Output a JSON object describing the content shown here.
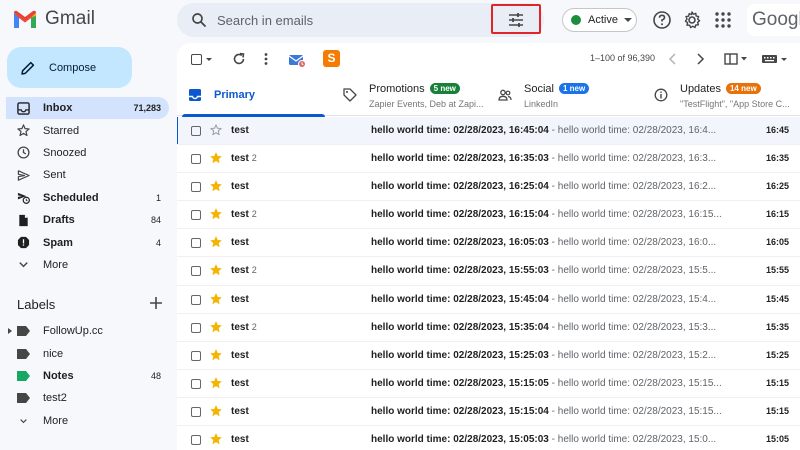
{
  "app": {
    "name": "Gmail",
    "brand": "Google"
  },
  "search": {
    "placeholder": "Search in emails"
  },
  "status": {
    "label": "Active",
    "color": "#1e8e3e"
  },
  "compose": {
    "label": "Compose"
  },
  "nav": [
    {
      "label": "Inbox",
      "count": "71,283",
      "icon": "inbox-icon",
      "active": true
    },
    {
      "label": "Starred",
      "count": "",
      "icon": "star-outline-icon"
    },
    {
      "label": "Snoozed",
      "count": "",
      "icon": "clock-icon"
    },
    {
      "label": "Sent",
      "count": "",
      "icon": "send-icon"
    },
    {
      "label": "Scheduled",
      "count": "1",
      "icon": "scheduled-send-icon",
      "bold": true
    },
    {
      "label": "Drafts",
      "count": "84",
      "icon": "draft-icon",
      "bold": true
    },
    {
      "label": "Spam",
      "count": "4",
      "icon": "spam-icon",
      "bold": true
    },
    {
      "label": "More",
      "count": "",
      "icon": "chevron-down-icon"
    }
  ],
  "labels": {
    "heading": "Labels",
    "items": [
      {
        "label": "FollowUp.cc",
        "count": "",
        "color": "#444746",
        "expandable": true
      },
      {
        "label": "nice",
        "count": "",
        "color": "#444746"
      },
      {
        "label": "Notes",
        "count": "48",
        "color": "#16a765",
        "bold": true
      },
      {
        "label": "test2",
        "count": "",
        "color": "#444746"
      },
      {
        "label": "More",
        "count": "",
        "icon": "chevron-down-icon"
      }
    ]
  },
  "toolbar": {
    "pagination": "1–100 of 96,390"
  },
  "tabs": [
    {
      "name": "Primary",
      "subtitle": "",
      "badge": "",
      "icon": "inbox-icon"
    },
    {
      "name": "Promotions",
      "subtitle": "Zapier Events, Deb at Zapi...",
      "badge": "5 new",
      "badge_color": "#188038",
      "icon": "tag-icon"
    },
    {
      "name": "Social",
      "subtitle": "LinkedIn",
      "badge": "1 new",
      "badge_color": "#1a73e8",
      "icon": "people-icon"
    },
    {
      "name": "Updates",
      "subtitle": "\"TestFlight\", \"App Store C...",
      "badge": "14 new",
      "badge_color": "#e8710a",
      "icon": "info-icon"
    }
  ],
  "emails": [
    {
      "sender": "test",
      "thread": "",
      "starred": false,
      "subject": "hello world time: 02/28/2023, 16:45:04",
      "snippet": "hello world time: 02/28/2023, 16:4...",
      "time": "16:45"
    },
    {
      "sender": "test",
      "thread": "2",
      "starred": true,
      "subject": "hello world time: 02/28/2023, 16:35:03",
      "snippet": "hello world time: 02/28/2023, 16:3...",
      "time": "16:35"
    },
    {
      "sender": "test",
      "thread": "",
      "starred": true,
      "subject": "hello world time: 02/28/2023, 16:25:04",
      "snippet": "hello world time: 02/28/2023, 16:2...",
      "time": "16:25"
    },
    {
      "sender": "test",
      "thread": "2",
      "starred": true,
      "subject": "hello world time: 02/28/2023, 16:15:04",
      "snippet": "hello world time: 02/28/2023, 16:15...",
      "time": "16:15"
    },
    {
      "sender": "test",
      "thread": "",
      "starred": true,
      "subject": "hello world time: 02/28/2023, 16:05:03",
      "snippet": "hello world time: 02/28/2023, 16:0...",
      "time": "16:05"
    },
    {
      "sender": "test",
      "thread": "2",
      "starred": true,
      "subject": "hello world time: 02/28/2023, 15:55:03",
      "snippet": "hello world time: 02/28/2023, 15:5...",
      "time": "15:55"
    },
    {
      "sender": "test",
      "thread": "",
      "starred": true,
      "subject": "hello world time: 02/28/2023, 15:45:04",
      "snippet": "hello world time: 02/28/2023, 15:4...",
      "time": "15:45"
    },
    {
      "sender": "test",
      "thread": "2",
      "starred": true,
      "subject": "hello world time: 02/28/2023, 15:35:04",
      "snippet": "hello world time: 02/28/2023, 15:3...",
      "time": "15:35"
    },
    {
      "sender": "test",
      "thread": "",
      "starred": true,
      "subject": "hello world time: 02/28/2023, 15:25:03",
      "snippet": "hello world time: 02/28/2023, 15:2...",
      "time": "15:25"
    },
    {
      "sender": "test",
      "thread": "",
      "starred": true,
      "subject": "hello world time: 02/28/2023, 15:15:05",
      "snippet": "hello world time: 02/28/2023, 15:15...",
      "time": "15:15"
    },
    {
      "sender": "test",
      "thread": "",
      "starred": true,
      "subject": "hello world time: 02/28/2023, 15:15:04",
      "snippet": "hello world time: 02/28/2023, 15:15...",
      "time": "15:15"
    },
    {
      "sender": "test",
      "thread": "",
      "starred": true,
      "subject": "hello world time: 02/28/2023, 15:05:03",
      "snippet": "hello world time: 02/28/2023, 15:0...",
      "time": "15:05"
    }
  ],
  "colors": {
    "accent": "#0b57d0",
    "star": "#f4b400",
    "highlight_box": "#e0242b"
  }
}
